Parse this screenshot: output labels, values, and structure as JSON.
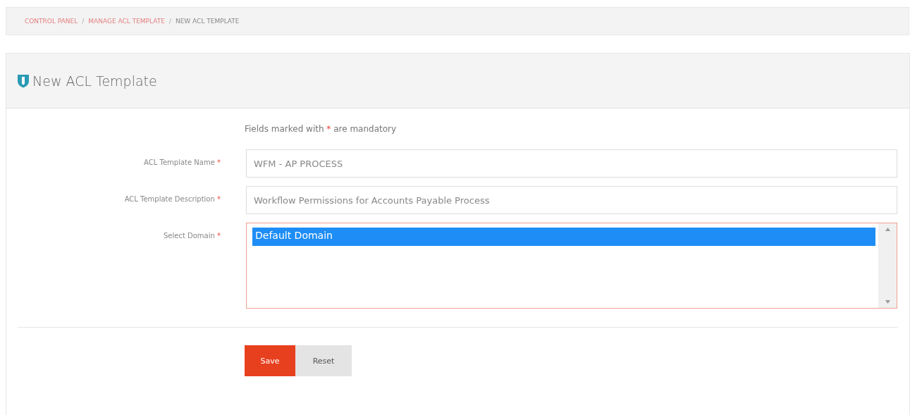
{
  "breadcrumb": [
    {
      "label": "CONTROL PANEL",
      "kind": "link"
    },
    {
      "label": "/",
      "kind": "separator"
    },
    {
      "label": "MANAGE ACL TEMPLATE",
      "kind": "link"
    },
    {
      "label": "/",
      "kind": "separator"
    },
    {
      "label": "NEW ACL TEMPLATE",
      "kind": "current"
    }
  ],
  "panel": {
    "title": "New ACL Template"
  },
  "notice": {
    "before": "Fields marked with ",
    "mark": "*",
    "after": " are mandatory"
  },
  "fields": [
    {
      "label": "ACL Template Name",
      "mark": "*",
      "kind": "text",
      "value": "WFM - AP PROCESS"
    },
    {
      "label": "ACL Template Description",
      "mark": "*",
      "kind": "text",
      "value": "Workflow Permissions for Accounts Payable Process"
    },
    {
      "label": "Select Domain",
      "mark": "*",
      "kind": "listbox",
      "options": [
        {
          "label": "Default Domain",
          "selected": true
        }
      ]
    }
  ],
  "buttons": [
    {
      "label": "Save",
      "kind": "primary"
    },
    {
      "label": "Reset",
      "kind": "secondary"
    }
  ]
}
